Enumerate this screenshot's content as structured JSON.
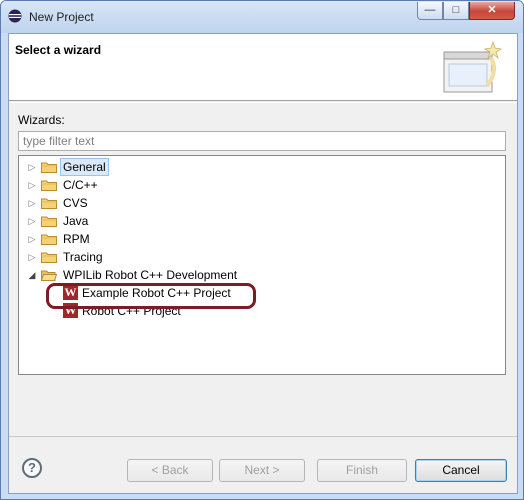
{
  "window": {
    "title": "New Project",
    "controls": {
      "minimize": "—",
      "maximize": "□",
      "close": "✕"
    }
  },
  "banner": {
    "title": "Select a wizard",
    "graphic_icon": "wizard-window-icon"
  },
  "wizards_label": "Wizards:",
  "filter": {
    "value": "",
    "placeholder": "type filter text"
  },
  "tree": {
    "items": [
      {
        "label": "General",
        "expanded": false,
        "selected": true,
        "icon": "folder-icon"
      },
      {
        "label": "C/C++",
        "expanded": false,
        "icon": "folder-icon"
      },
      {
        "label": "CVS",
        "expanded": false,
        "icon": "folder-icon"
      },
      {
        "label": "Java",
        "expanded": false,
        "icon": "folder-icon"
      },
      {
        "label": "RPM",
        "expanded": false,
        "icon": "folder-icon"
      },
      {
        "label": "Tracing",
        "expanded": false,
        "icon": "folder-icon"
      },
      {
        "label": "WPILib Robot C++ Development",
        "expanded": true,
        "icon": "folder-open-icon",
        "children": [
          {
            "label": "Example Robot C++ Project",
            "icon": "wpilib-w-icon",
            "icon_text": "W",
            "highlighted": true
          },
          {
            "label": "Robot C++ Project",
            "icon": "wpilib-w-icon",
            "icon_text": "W"
          }
        ]
      }
    ]
  },
  "buttons": {
    "help": "?",
    "back": "< Back",
    "next": "Next >",
    "finish": "Finish",
    "cancel": "Cancel"
  },
  "colors": {
    "accent": "#3c7fb1",
    "highlight_ring": "#7a1d24",
    "wpilib_icon": "#a3262a"
  }
}
